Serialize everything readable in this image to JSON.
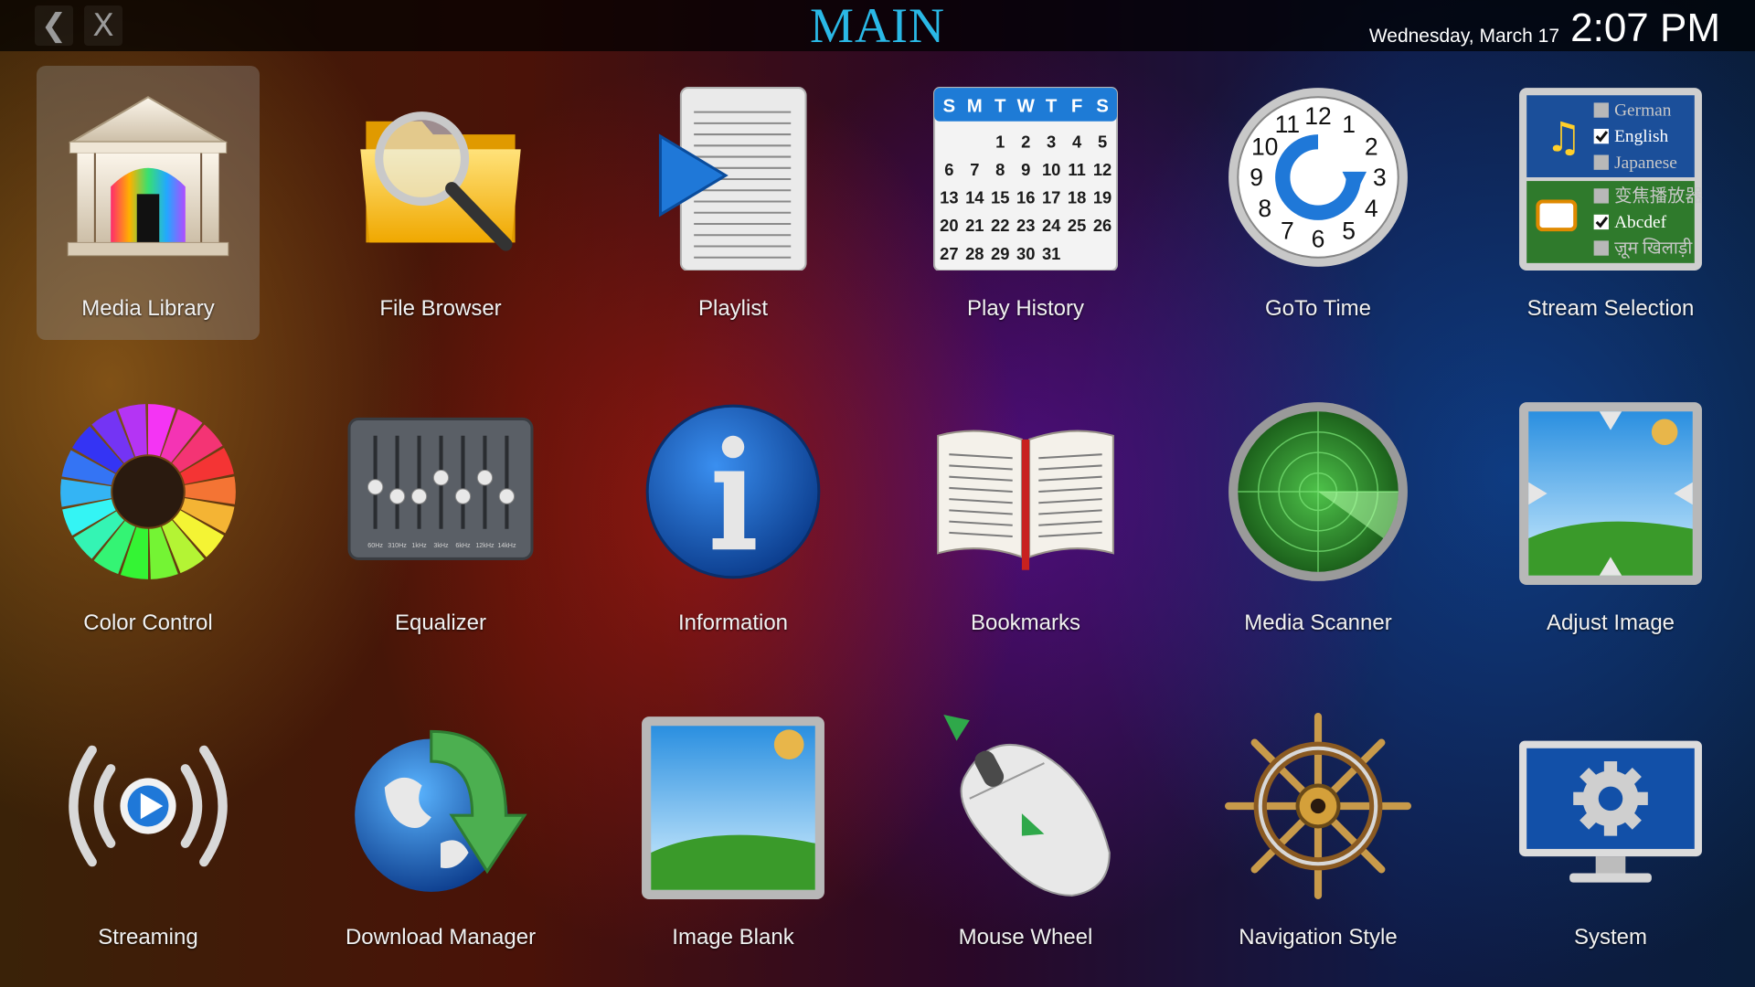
{
  "header": {
    "title": "MAIN",
    "back_label": "❮",
    "close_label": "X",
    "date": "Wednesday, March 17",
    "time": "2:07 PM"
  },
  "tiles": [
    {
      "label": "Media Library",
      "icon": "temple-icon",
      "selected": true
    },
    {
      "label": "File Browser",
      "icon": "folder-magnifier-icon"
    },
    {
      "label": "Playlist",
      "icon": "playlist-icon"
    },
    {
      "label": "Play History",
      "icon": "calendar-icon"
    },
    {
      "label": "GoTo Time",
      "icon": "clock-icon"
    },
    {
      "label": "Stream Selection",
      "icon": "stream-selection-icon"
    },
    {
      "label": "Color Control",
      "icon": "color-wheel-icon"
    },
    {
      "label": "Equalizer",
      "icon": "equalizer-icon"
    },
    {
      "label": "Information",
      "icon": "info-icon"
    },
    {
      "label": "Bookmarks",
      "icon": "book-icon"
    },
    {
      "label": "Media Scanner",
      "icon": "radar-icon"
    },
    {
      "label": "Adjust Image",
      "icon": "adjust-image-icon"
    },
    {
      "label": "Streaming",
      "icon": "streaming-icon"
    },
    {
      "label": "Download Manager",
      "icon": "globe-download-icon"
    },
    {
      "label": "Image Blank",
      "icon": "image-blank-icon"
    },
    {
      "label": "Mouse Wheel",
      "icon": "mouse-icon"
    },
    {
      "label": "Navigation Style",
      "icon": "ship-wheel-icon"
    },
    {
      "label": "System",
      "icon": "monitor-gear-icon"
    }
  ],
  "calendar": {
    "weekdays": [
      "S",
      "M",
      "T",
      "W",
      "T",
      "F",
      "S"
    ],
    "rows": [
      [
        "",
        "",
        "1",
        "2",
        "3",
        "4",
        "5"
      ],
      [
        "6",
        "7",
        "8",
        "9",
        "10",
        "11",
        "12"
      ],
      [
        "13",
        "14",
        "15",
        "16",
        "17",
        "18",
        "19"
      ],
      [
        "20",
        "21",
        "22",
        "23",
        "24",
        "25",
        "26"
      ],
      [
        "27",
        "28",
        "29",
        "30",
        "31",
        "",
        ""
      ]
    ]
  },
  "clock_numbers": [
    "12",
    "1",
    "2",
    "3",
    "4",
    "5",
    "6",
    "7",
    "8",
    "9",
    "10",
    "11"
  ],
  "stream_selection": {
    "audio": [
      {
        "label": "German",
        "checked": false
      },
      {
        "label": "English",
        "checked": true
      },
      {
        "label": "Japanese",
        "checked": false
      }
    ],
    "subtitles": [
      {
        "label": "变焦播放器",
        "checked": false
      },
      {
        "label": "Abcdef",
        "checked": true
      },
      {
        "label": "ज़ूम खिलाड़ी",
        "checked": false
      }
    ]
  },
  "equalizer": {
    "bands": [
      "60Hz",
      "310Hz",
      "1kHz",
      "3kHz",
      "6kHz",
      "12kHz",
      "14kHz"
    ],
    "levels": [
      0.45,
      0.35,
      0.35,
      0.55,
      0.35,
      0.55,
      0.35
    ]
  },
  "colors": {
    "title": "#2ab8e6",
    "accent_blue": "#1a6fd0",
    "green": "#4caf50"
  }
}
